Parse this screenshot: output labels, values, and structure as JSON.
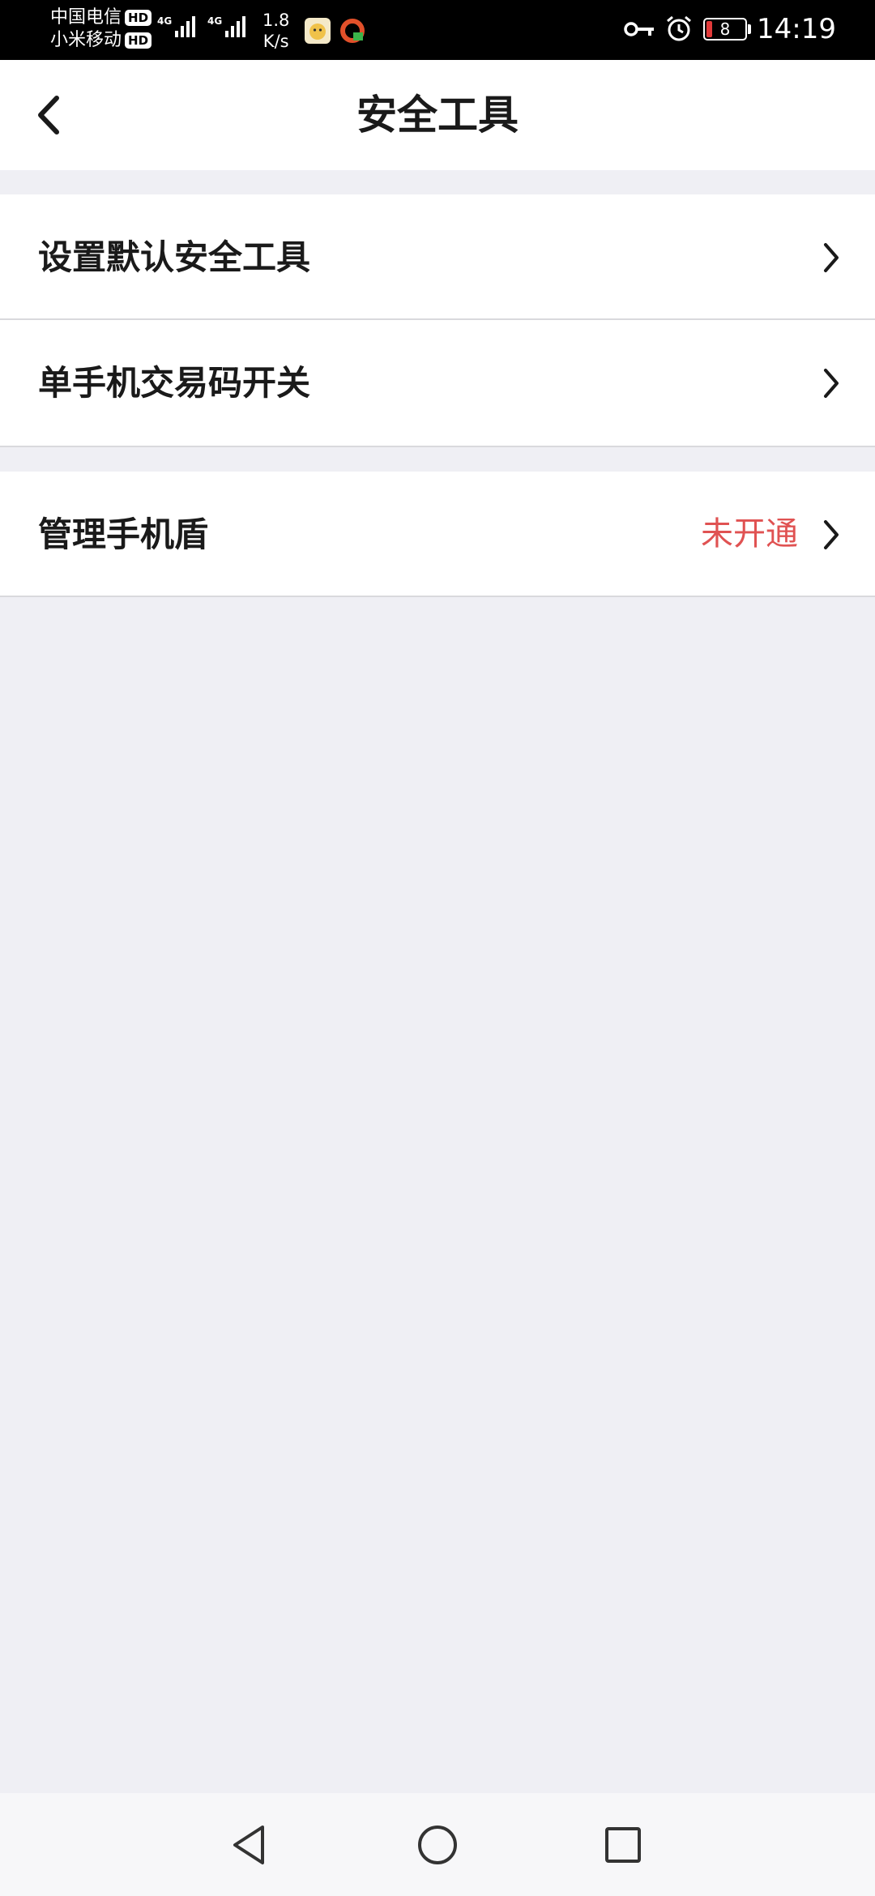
{
  "status_bar": {
    "carrier_1": "中国电信",
    "carrier_2": "小米移动",
    "hd_label": "HD",
    "network_type": "4G",
    "speed_value": "1.8",
    "speed_unit": "K/s",
    "battery_level": "8",
    "time": "14:19",
    "icons": [
      "signal-icon",
      "notification-app-icon",
      "vpn-key-icon",
      "alarm-icon",
      "battery-icon"
    ]
  },
  "nav": {
    "title": "安全工具",
    "back_icon": "chevron-left-icon"
  },
  "menu": {
    "group_1": [
      {
        "label": "设置默认安全工具"
      },
      {
        "label": "单手机交易码开关"
      }
    ],
    "group_2": [
      {
        "label": "管理手机盾",
        "value": "未开通"
      }
    ]
  },
  "colors": {
    "background": "#efeff4",
    "card": "#ffffff",
    "text": "#1a1a1a",
    "status_value": "#e05252"
  },
  "system_nav": {
    "icons": [
      "back-triangle-icon",
      "home-circle-icon",
      "recents-square-icon"
    ]
  }
}
